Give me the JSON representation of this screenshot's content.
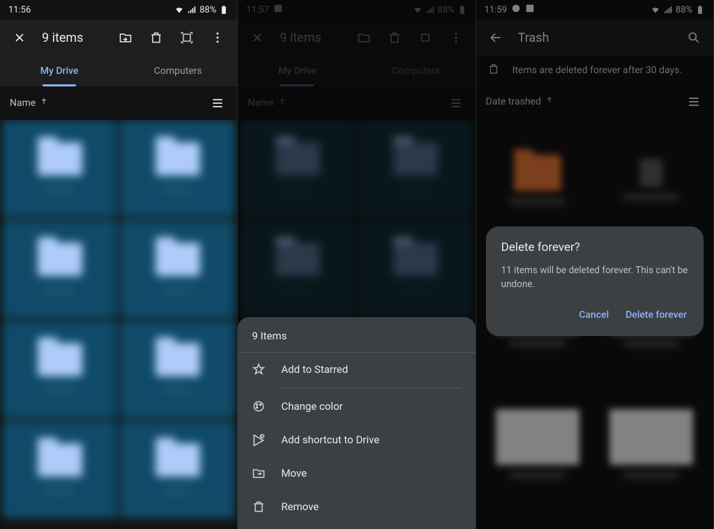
{
  "screens": [
    {
      "status_time": "11:56",
      "battery_text": "88%",
      "title": "9 items",
      "tabs": {
        "my_drive": "My Drive",
        "computers": "Computers"
      },
      "sort_label": "Name",
      "view_toggle": "list"
    },
    {
      "status_time": "11:57",
      "battery_text": "88%",
      "title": "9 items",
      "tabs": {
        "my_drive": "My Drive",
        "computers": "Computers"
      },
      "sort_label": "Name",
      "sheet": {
        "header": "9 Items",
        "items": [
          "Add to Starred",
          "Change color",
          "Add shortcut to Drive",
          "Move",
          "Remove"
        ]
      }
    },
    {
      "status_time": "11:59",
      "battery_text": "88%",
      "title": "Trash",
      "notice": "Items are deleted forever after 30 days.",
      "sort_label": "Date trashed",
      "dialog": {
        "title": "Delete forever?",
        "body": "11 items will be deleted forever. This can't be undone.",
        "cancel": "Cancel",
        "confirm": "Delete forever"
      }
    }
  ]
}
